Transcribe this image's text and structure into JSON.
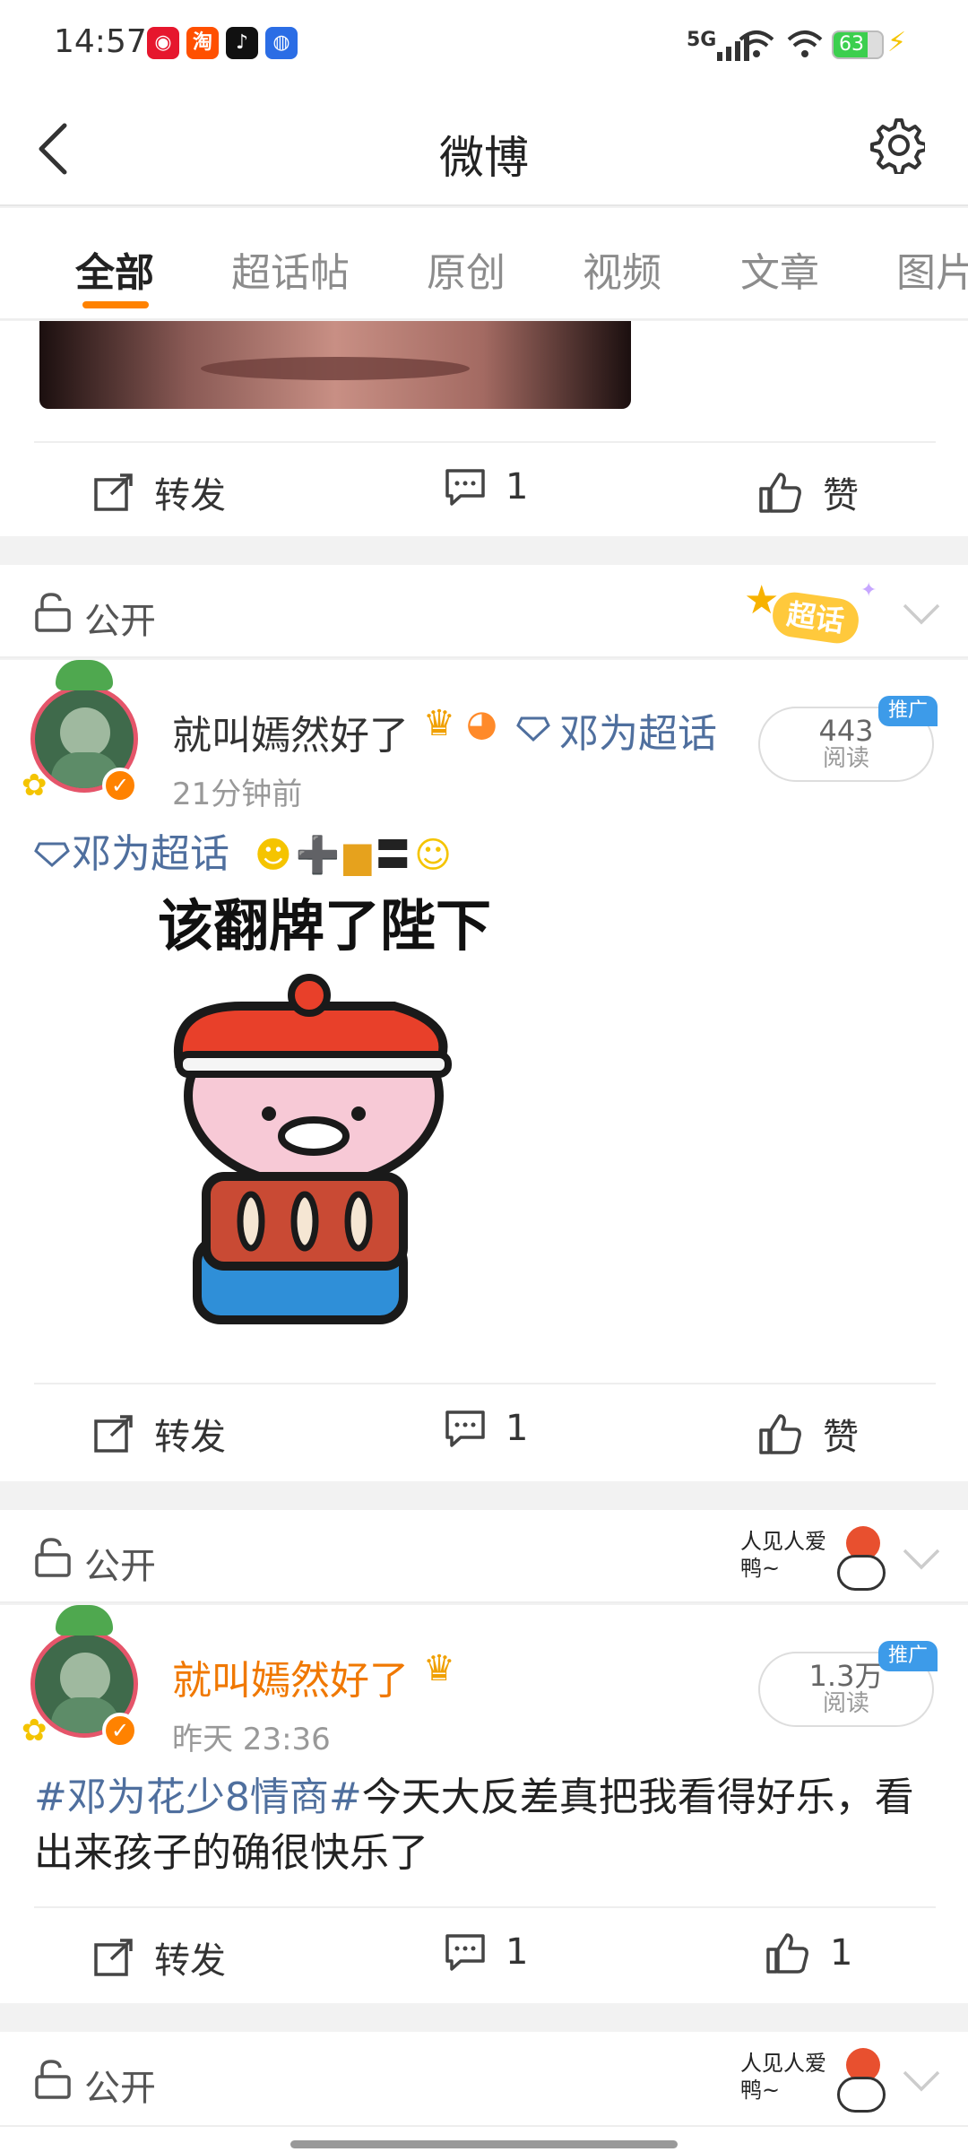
{
  "status_bar": {
    "time": "14:57",
    "network": "5G",
    "battery": "63",
    "app_icons": [
      "weibo-icon",
      "taobao-icon",
      "douyin-icon",
      "baidu-icon"
    ]
  },
  "header": {
    "title": "微博",
    "back_icon": "back-arrow-icon",
    "settings_icon": "gear-icon"
  },
  "tabs": [
    {
      "label": "全部",
      "active": true
    },
    {
      "label": "超话帖",
      "active": false
    },
    {
      "label": "原创",
      "active": false
    },
    {
      "label": "视频",
      "active": false
    },
    {
      "label": "文章",
      "active": false
    },
    {
      "label": "图片",
      "active": false
    }
  ],
  "accent_color": "#ff8200",
  "link_color": "#4f6f9e",
  "post0_actions": {
    "repost": "转发",
    "comment": "1",
    "like": "赞"
  },
  "post1": {
    "visibility": "公开",
    "sticker_text": "超话",
    "username": "就叫嫣然好了",
    "supertopic_name": "邓为超话",
    "time": "21分钟前",
    "reads_count": "443",
    "reads_label": "阅读",
    "promo_badge": "推广",
    "text_link": "邓为超话",
    "image_caption": "该翻牌了陛下",
    "actions": {
      "repost": "转发",
      "comment": "1",
      "like": "赞"
    }
  },
  "post2": {
    "visibility": "公开",
    "sticker_text": "人见人爱 鸭~",
    "username": "就叫嫣然好了",
    "time": "昨天 23:36",
    "reads_count": "1.3万",
    "reads_label": "阅读",
    "promo_badge": "推广",
    "hashtag": "#邓为花少8情商#",
    "text_line1": "今天大反差真把我看得好乐，看",
    "text_line2": "出来孩子的确很快乐了",
    "actions": {
      "repost": "转发",
      "comment": "1",
      "like": "1"
    }
  },
  "post3": {
    "visibility": "公开",
    "sticker_text": "人见人爱 鸭~"
  }
}
